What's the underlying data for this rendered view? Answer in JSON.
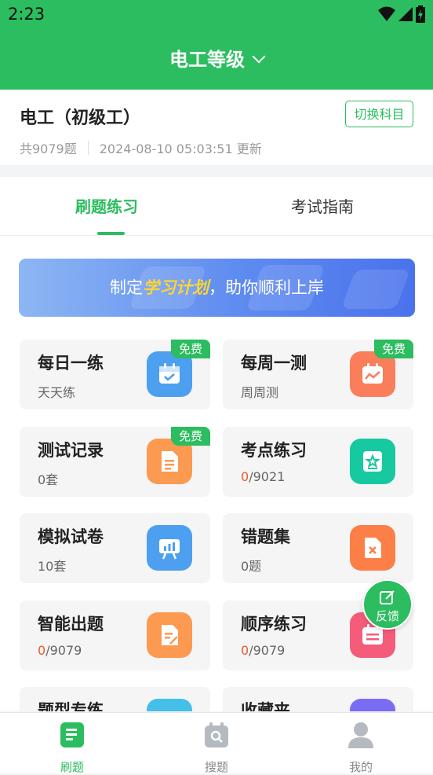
{
  "status": {
    "time": "2:23"
  },
  "header": {
    "title": "电工等级"
  },
  "subject": {
    "name": "电工（初级工）",
    "count": "共9079题",
    "updated": "2024-08-10 05:03:51 更新",
    "switch_label": "切换科目"
  },
  "tabs": [
    {
      "label": "刷题练习",
      "active": true
    },
    {
      "label": "考试指南",
      "active": false
    }
  ],
  "banner": {
    "prefix": "制定",
    "highlight": "学习计划",
    "suffix": "，助你顺利上岸"
  },
  "cards": [
    {
      "title": "每日一练",
      "sub": "天天练",
      "badge": "免费",
      "icon": "calendar-check-icon",
      "color": "#4d9ff0"
    },
    {
      "title": "每周一测",
      "sub": "周周测",
      "badge": "免费",
      "icon": "calendar-chart-icon",
      "color": "#fa7e5a"
    },
    {
      "title": "测试记录",
      "sub": "0套",
      "badge": "免费",
      "icon": "document-icon",
      "color": "#fb9a50"
    },
    {
      "title": "考点练习",
      "sub_num": "0",
      "sub_rest": "/9021",
      "icon": "star-board-icon",
      "color": "#17c9a0"
    },
    {
      "title": "模拟试卷",
      "sub": "10套",
      "icon": "presentation-icon",
      "color": "#4d9ff0"
    },
    {
      "title": "错题集",
      "sub": "0题",
      "icon": "wrong-doc-icon",
      "color": "#fb7f47"
    },
    {
      "title": "智能出题",
      "sub_num": "0",
      "sub_rest": "/9079",
      "icon": "edit-doc-icon",
      "color": "#fb9a50"
    },
    {
      "title": "顺序练习",
      "sub_num": "0",
      "sub_rest": "/9079",
      "icon": "list-calendar-icon",
      "color": "#f55c79"
    },
    {
      "title": "题型专练",
      "icon": "grid-icon",
      "color": "#43bfe8"
    },
    {
      "title": "收藏夹",
      "icon": "bookmark-icon",
      "color": "#7b6cf6"
    }
  ],
  "feedback": {
    "label": "反馈"
  },
  "bottom_nav": [
    {
      "label": "刷题",
      "active": true
    },
    {
      "label": "搜题",
      "active": false
    },
    {
      "label": "我的",
      "active": false
    }
  ],
  "colors": {
    "brand": "#2bbd5f",
    "accent_red": "#f0582a"
  }
}
